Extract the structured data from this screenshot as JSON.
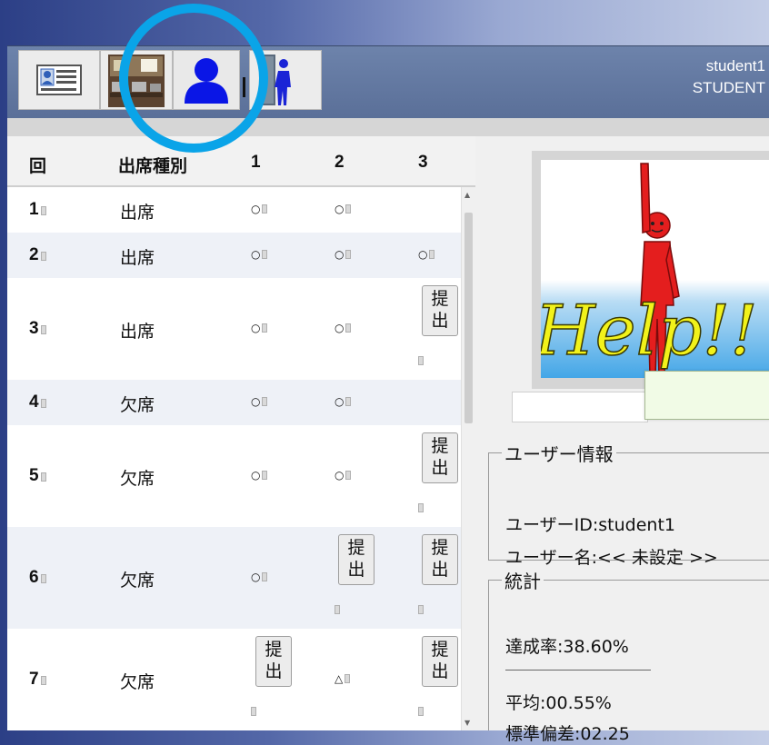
{
  "user": {
    "id": "student1",
    "role": "STUDENT"
  },
  "toolbar": {
    "buttons": [
      {
        "name": "profile-card-button",
        "icon": "id-card-icon"
      },
      {
        "name": "classroom-button",
        "icon": "classroom-photo-icon"
      },
      {
        "name": "user-button",
        "icon": "person-icon",
        "active": true
      },
      {
        "name": "attendance-button",
        "icon": "person-door-icon"
      }
    ]
  },
  "table": {
    "headers": [
      "回",
      "出席種別",
      "1",
      "2",
      "3"
    ],
    "rows": [
      {
        "no": "1",
        "type": "出席",
        "c1": "○",
        "c2": "○",
        "c3": ""
      },
      {
        "no": "2",
        "type": "出席",
        "c1": "○",
        "c2": "○",
        "c3": "○"
      },
      {
        "no": "3",
        "type": "出席",
        "c1": "○",
        "c2": "○",
        "c3": "submit"
      },
      {
        "no": "4",
        "type": "欠席",
        "c1": "○",
        "c2": "○",
        "c3": ""
      },
      {
        "no": "5",
        "type": "欠席",
        "c1": "○",
        "c2": "○",
        "c3": "submit"
      },
      {
        "no": "6",
        "type": "欠席",
        "c1": "○",
        "c2": "submit",
        "c3": "submit"
      },
      {
        "no": "7",
        "type": "欠席",
        "c1": "submit",
        "c2": "△",
        "c3": "submit"
      }
    ],
    "submit_label": "提出"
  },
  "help": {
    "text": "Help!!"
  },
  "user_info": {
    "legend": "ユーザー情報",
    "id_line": "ユーザーID:student1",
    "name_line": "ユーザー名:<< 未設定 >>"
  },
  "stats": {
    "legend": "統計",
    "achievement": "達成率:38.60%",
    "average": "平均:00.55%",
    "std_dev": "標準偏差:02.25"
  },
  "colors": {
    "accent_ring": "#0aa4e8",
    "toolbar": "#5a6f98",
    "help_figure": "#e41e1e",
    "help_text": "#f2f21a"
  }
}
